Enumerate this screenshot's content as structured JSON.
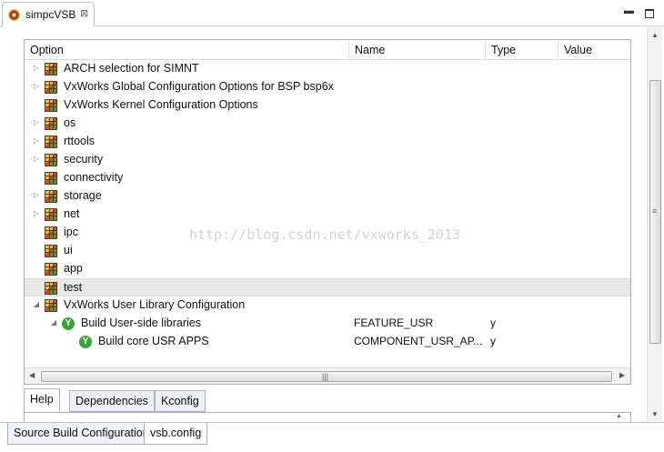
{
  "editor_tab": {
    "title": "simpcVSB",
    "close": "⊠"
  },
  "window": {
    "minimize": "▬"
  },
  "columns": {
    "option": "Option",
    "name": "Name",
    "type": "Type",
    "value": "Value"
  },
  "rows": [
    {
      "label": "ARCH selection for SIMNT",
      "expander": "▷",
      "icon": "package-icon",
      "name": "",
      "type": "",
      "value": ""
    },
    {
      "label": "VxWorks Global Configuration Options for BSP bsp6x",
      "expander": "▷",
      "icon": "package-icon",
      "name": "",
      "type": "",
      "value": ""
    },
    {
      "label": "VxWorks Kernel Configuration Options",
      "expander": "",
      "icon": "package-icon",
      "name": "",
      "type": "",
      "value": ""
    },
    {
      "label": "os",
      "expander": "▷",
      "icon": "package-icon",
      "name": "",
      "type": "",
      "value": ""
    },
    {
      "label": "rttools",
      "expander": "▷",
      "icon": "package-icon",
      "name": "",
      "type": "",
      "value": ""
    },
    {
      "label": "security",
      "expander": "▷",
      "icon": "package-icon",
      "name": "",
      "type": "",
      "value": ""
    },
    {
      "label": "connectivity",
      "expander": "",
      "icon": "package-icon",
      "name": "",
      "type": "",
      "value": ""
    },
    {
      "label": "storage",
      "expander": "▷",
      "icon": "package-icon",
      "name": "",
      "type": "",
      "value": ""
    },
    {
      "label": "net",
      "expander": "▷",
      "icon": "package-icon",
      "name": "",
      "type": "",
      "value": ""
    },
    {
      "label": "ipc",
      "expander": "",
      "icon": "package-icon",
      "name": "",
      "type": "",
      "value": ""
    },
    {
      "label": "ui",
      "expander": "",
      "icon": "package-icon",
      "name": "",
      "type": "",
      "value": ""
    },
    {
      "label": "app",
      "expander": "",
      "icon": "package-icon",
      "name": "",
      "type": "",
      "value": ""
    },
    {
      "label": "test",
      "expander": "",
      "icon": "package-icon",
      "name": "",
      "type": "",
      "value": "",
      "selected": true
    },
    {
      "label": "VxWorks User Library Configuration",
      "expander": "◢",
      "icon": "package-icon",
      "name": "",
      "type": "",
      "value": ""
    },
    {
      "label": "Build User-side libraries",
      "expander": "◢",
      "icon": "y-badge-icon",
      "badge": "Y",
      "name": "FEATURE_USR",
      "type": "y",
      "value": ""
    },
    {
      "label": "Build core USR APPS",
      "expander": "",
      "icon": "y-badge-icon",
      "badge": "Y",
      "name": "COMPONENT_USR_AP...",
      "type": "y",
      "value": ""
    }
  ],
  "watermark": "http://blog.csdn.net/vxworks_2013",
  "hscroll": {
    "left": "◀",
    "right": "▶",
    "grip": "|||"
  },
  "vscroll": {
    "up": "▲",
    "down": "▼",
    "grip": "≡"
  },
  "lower_tabs": [
    "Help",
    "Dependencies",
    "Kconfig"
  ],
  "lower_panel_arrow": "▲",
  "page_tabs": [
    "Source Build Configuration",
    "vsb.config"
  ]
}
